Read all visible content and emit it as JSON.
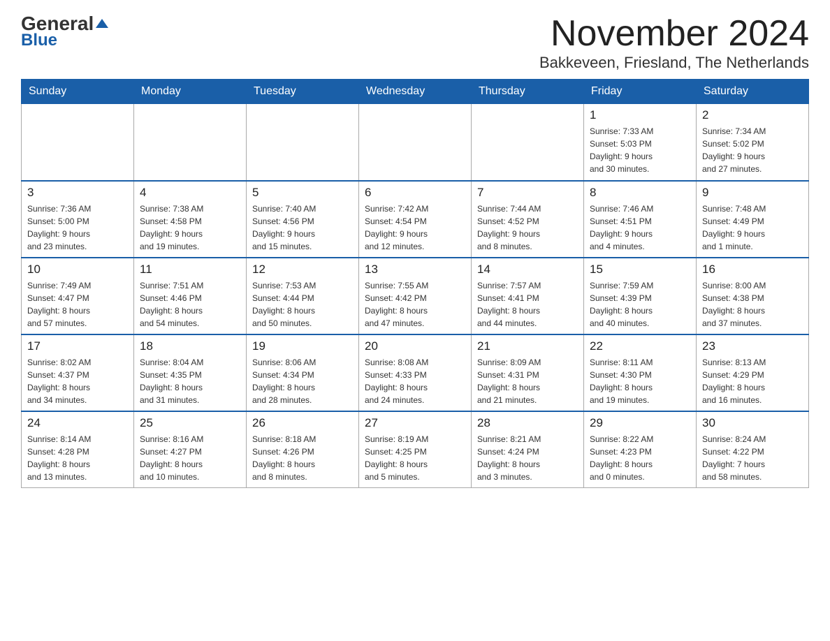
{
  "logo": {
    "text_general": "General",
    "text_blue": "Blue"
  },
  "header": {
    "month_title": "November 2024",
    "location": "Bakkeveen, Friesland, The Netherlands"
  },
  "weekdays": [
    "Sunday",
    "Monday",
    "Tuesday",
    "Wednesday",
    "Thursday",
    "Friday",
    "Saturday"
  ],
  "weeks": [
    [
      {
        "day": "",
        "info": ""
      },
      {
        "day": "",
        "info": ""
      },
      {
        "day": "",
        "info": ""
      },
      {
        "day": "",
        "info": ""
      },
      {
        "day": "",
        "info": ""
      },
      {
        "day": "1",
        "info": "Sunrise: 7:33 AM\nSunset: 5:03 PM\nDaylight: 9 hours\nand 30 minutes."
      },
      {
        "day": "2",
        "info": "Sunrise: 7:34 AM\nSunset: 5:02 PM\nDaylight: 9 hours\nand 27 minutes."
      }
    ],
    [
      {
        "day": "3",
        "info": "Sunrise: 7:36 AM\nSunset: 5:00 PM\nDaylight: 9 hours\nand 23 minutes."
      },
      {
        "day": "4",
        "info": "Sunrise: 7:38 AM\nSunset: 4:58 PM\nDaylight: 9 hours\nand 19 minutes."
      },
      {
        "day": "5",
        "info": "Sunrise: 7:40 AM\nSunset: 4:56 PM\nDaylight: 9 hours\nand 15 minutes."
      },
      {
        "day": "6",
        "info": "Sunrise: 7:42 AM\nSunset: 4:54 PM\nDaylight: 9 hours\nand 12 minutes."
      },
      {
        "day": "7",
        "info": "Sunrise: 7:44 AM\nSunset: 4:52 PM\nDaylight: 9 hours\nand 8 minutes."
      },
      {
        "day": "8",
        "info": "Sunrise: 7:46 AM\nSunset: 4:51 PM\nDaylight: 9 hours\nand 4 minutes."
      },
      {
        "day": "9",
        "info": "Sunrise: 7:48 AM\nSunset: 4:49 PM\nDaylight: 9 hours\nand 1 minute."
      }
    ],
    [
      {
        "day": "10",
        "info": "Sunrise: 7:49 AM\nSunset: 4:47 PM\nDaylight: 8 hours\nand 57 minutes."
      },
      {
        "day": "11",
        "info": "Sunrise: 7:51 AM\nSunset: 4:46 PM\nDaylight: 8 hours\nand 54 minutes."
      },
      {
        "day": "12",
        "info": "Sunrise: 7:53 AM\nSunset: 4:44 PM\nDaylight: 8 hours\nand 50 minutes."
      },
      {
        "day": "13",
        "info": "Sunrise: 7:55 AM\nSunset: 4:42 PM\nDaylight: 8 hours\nand 47 minutes."
      },
      {
        "day": "14",
        "info": "Sunrise: 7:57 AM\nSunset: 4:41 PM\nDaylight: 8 hours\nand 44 minutes."
      },
      {
        "day": "15",
        "info": "Sunrise: 7:59 AM\nSunset: 4:39 PM\nDaylight: 8 hours\nand 40 minutes."
      },
      {
        "day": "16",
        "info": "Sunrise: 8:00 AM\nSunset: 4:38 PM\nDaylight: 8 hours\nand 37 minutes."
      }
    ],
    [
      {
        "day": "17",
        "info": "Sunrise: 8:02 AM\nSunset: 4:37 PM\nDaylight: 8 hours\nand 34 minutes."
      },
      {
        "day": "18",
        "info": "Sunrise: 8:04 AM\nSunset: 4:35 PM\nDaylight: 8 hours\nand 31 minutes."
      },
      {
        "day": "19",
        "info": "Sunrise: 8:06 AM\nSunset: 4:34 PM\nDaylight: 8 hours\nand 28 minutes."
      },
      {
        "day": "20",
        "info": "Sunrise: 8:08 AM\nSunset: 4:33 PM\nDaylight: 8 hours\nand 24 minutes."
      },
      {
        "day": "21",
        "info": "Sunrise: 8:09 AM\nSunset: 4:31 PM\nDaylight: 8 hours\nand 21 minutes."
      },
      {
        "day": "22",
        "info": "Sunrise: 8:11 AM\nSunset: 4:30 PM\nDaylight: 8 hours\nand 19 minutes."
      },
      {
        "day": "23",
        "info": "Sunrise: 8:13 AM\nSunset: 4:29 PM\nDaylight: 8 hours\nand 16 minutes."
      }
    ],
    [
      {
        "day": "24",
        "info": "Sunrise: 8:14 AM\nSunset: 4:28 PM\nDaylight: 8 hours\nand 13 minutes."
      },
      {
        "day": "25",
        "info": "Sunrise: 8:16 AM\nSunset: 4:27 PM\nDaylight: 8 hours\nand 10 minutes."
      },
      {
        "day": "26",
        "info": "Sunrise: 8:18 AM\nSunset: 4:26 PM\nDaylight: 8 hours\nand 8 minutes."
      },
      {
        "day": "27",
        "info": "Sunrise: 8:19 AM\nSunset: 4:25 PM\nDaylight: 8 hours\nand 5 minutes."
      },
      {
        "day": "28",
        "info": "Sunrise: 8:21 AM\nSunset: 4:24 PM\nDaylight: 8 hours\nand 3 minutes."
      },
      {
        "day": "29",
        "info": "Sunrise: 8:22 AM\nSunset: 4:23 PM\nDaylight: 8 hours\nand 0 minutes."
      },
      {
        "day": "30",
        "info": "Sunrise: 8:24 AM\nSunset: 4:22 PM\nDaylight: 7 hours\nand 58 minutes."
      }
    ]
  ]
}
